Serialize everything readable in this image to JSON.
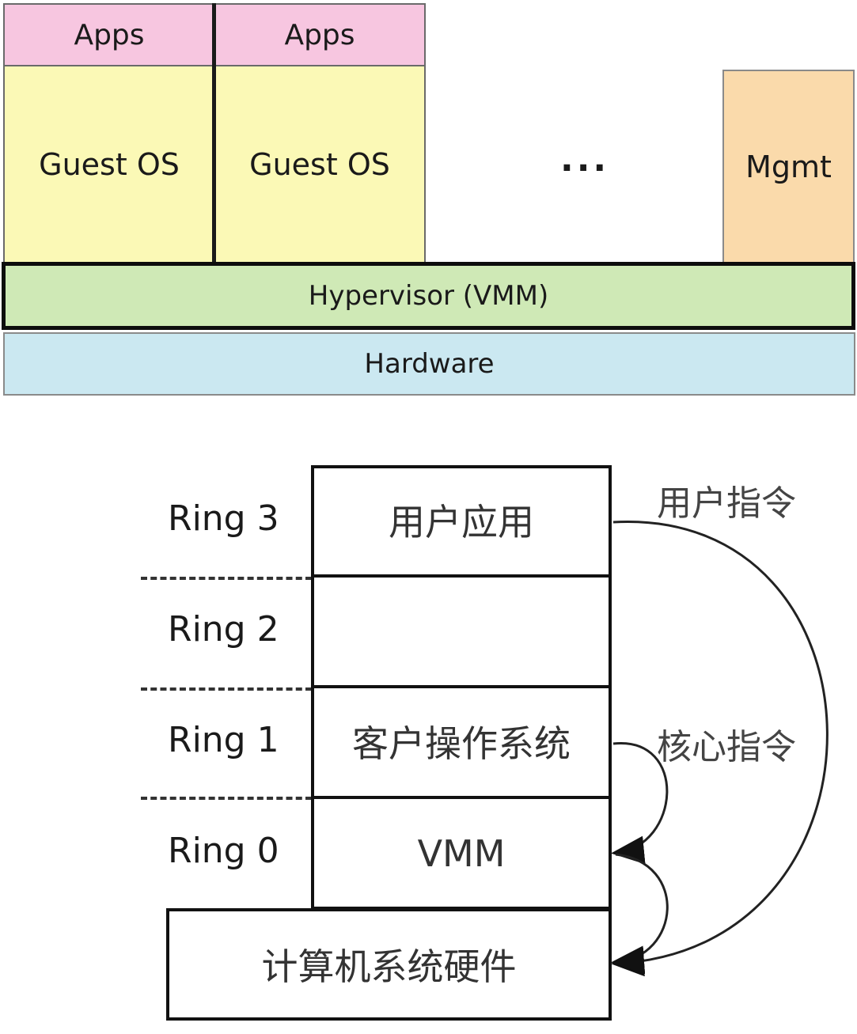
{
  "top": {
    "apps_1": "Apps",
    "apps_2": "Apps",
    "guest_1": "Guest OS",
    "guest_2": "Guest OS",
    "ellipsis": "...",
    "mgmt": "Mgmt",
    "hypervisor": "Hypervisor (VMM)",
    "hardware": "Hardware",
    "colors": {
      "apps": "#f7c6e0",
      "guest_os": "#fbf9b6",
      "mgmt": "#fadaab",
      "hypervisor": "#cfe9b6",
      "hardware": "#cbe8f1"
    }
  },
  "bottom": {
    "rings": [
      "Ring 3",
      "Ring 2",
      "Ring 1",
      "Ring 0"
    ],
    "stack": {
      "ring3": "用户应用",
      "ring2": "",
      "ring1": "客户操作系统",
      "ring0": "VMM",
      "hardware": "计算机系统硬件"
    },
    "user_instr": "用户指令",
    "kernel_instr": "核心指令"
  }
}
